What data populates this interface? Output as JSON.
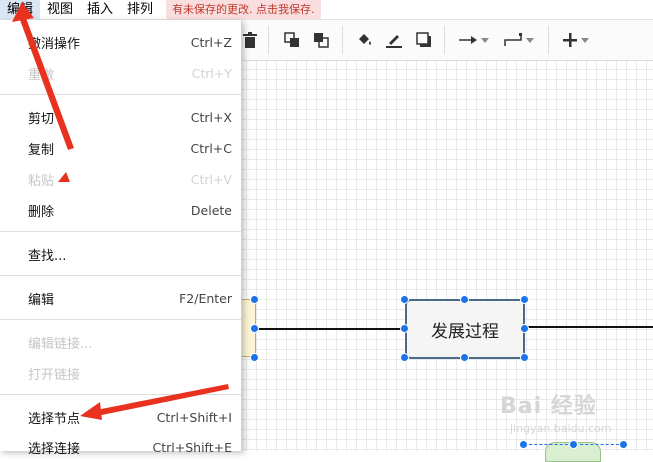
{
  "menubar": {
    "items": [
      "编辑",
      "视图",
      "插入",
      "排列"
    ],
    "unsaved_notice": "有未保存的更改. 点击我保存."
  },
  "toolbar": {
    "icons": [
      "delete-icon",
      "to-front-icon",
      "to-back-icon",
      "fill-color-icon",
      "line-color-icon",
      "shadow-icon",
      "connection-icon",
      "waypoints-icon",
      "insert-icon"
    ]
  },
  "edit_menu": {
    "items": [
      {
        "label": "撤消操作",
        "shortcut": "Ctrl+Z",
        "enabled": true
      },
      {
        "label": "重做",
        "shortcut": "Ctrl+Y",
        "enabled": false
      },
      {
        "label": "剪切",
        "shortcut": "Ctrl+X",
        "enabled": true
      },
      {
        "label": "复制",
        "shortcut": "Ctrl+C",
        "enabled": true
      },
      {
        "label": "粘贴",
        "shortcut": "Ctrl+V",
        "enabled": false
      },
      {
        "label": "删除",
        "shortcut": "Delete",
        "enabled": true
      },
      {
        "label": "查找...",
        "shortcut": "",
        "enabled": true
      },
      {
        "label": "编辑",
        "shortcut": "F2/Enter",
        "enabled": true
      },
      {
        "label": "编辑链接...",
        "shortcut": "",
        "enabled": false
      },
      {
        "label": "打开链接",
        "shortcut": "",
        "enabled": false
      },
      {
        "label": "选择节点",
        "shortcut": "Ctrl+Shift+I",
        "enabled": true
      },
      {
        "label": "选择连接",
        "shortcut": "Ctrl+Shift+E",
        "enabled": true
      }
    ]
  },
  "canvas": {
    "node_label": "发展过程"
  },
  "watermark": {
    "text": "Bai 经验",
    "sub": "jingyan.baidu.com"
  },
  "colors": {
    "accent": "#1a73e8",
    "annotation": "#e8321f",
    "unsaved_bg": "#f8dede",
    "unsaved_text": "#c0392b"
  }
}
